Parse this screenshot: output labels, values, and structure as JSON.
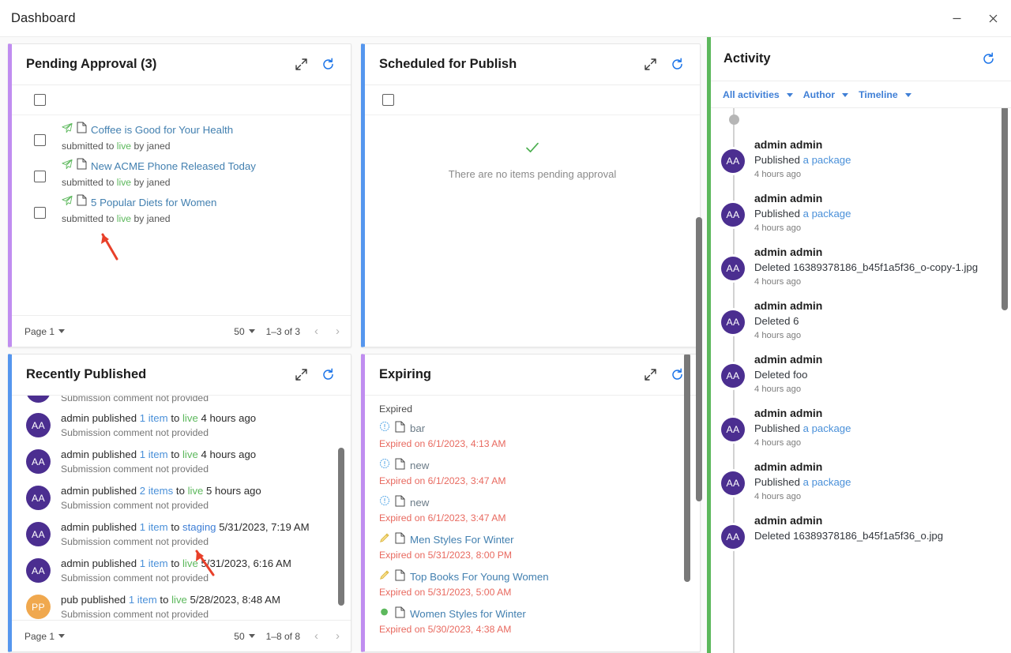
{
  "window": {
    "title": "Dashboard",
    "minimize_label": "Minimize",
    "close_label": "Close"
  },
  "pending_approval": {
    "title": "Pending Approval (3)",
    "expand_label": "Expand",
    "refresh_label": "Refresh",
    "items": [
      {
        "icon": "send-icon",
        "title": "Coffee is Good for Your Health",
        "prefix": "submitted to",
        "target": "live",
        "suffix": "by janed"
      },
      {
        "icon": "send-icon",
        "title": "New ACME Phone Released Today",
        "prefix": "submitted to",
        "target": "live",
        "suffix": "by janed"
      },
      {
        "icon": "send-icon",
        "title": "5 Popular Diets for Women",
        "prefix": "submitted to",
        "target": "live",
        "suffix": "by janed"
      }
    ],
    "pager": {
      "page_label": "Page 1",
      "per_page": "50",
      "range": "1–3 of 3"
    }
  },
  "scheduled_for_publish": {
    "title": "Scheduled for Publish",
    "empty_text": "There are no items pending approval",
    "empty_icon": "check-icon"
  },
  "recently_published": {
    "title": "Recently Published",
    "clipped_top_text": "Submission comment not provided",
    "items": [
      {
        "avatar": "AA",
        "avatar_color": "#4b2e90",
        "actor": "admin published",
        "count": "1 item",
        "to": "to",
        "target": "live",
        "target_type": "live",
        "time": "4 hours ago",
        "comment": "Submission comment not provided"
      },
      {
        "avatar": "AA",
        "avatar_color": "#4b2e90",
        "actor": "admin published",
        "count": "1 item",
        "to": "to",
        "target": "live",
        "target_type": "live",
        "time": "4 hours ago",
        "comment": "Submission comment not provided"
      },
      {
        "avatar": "AA",
        "avatar_color": "#4b2e90",
        "actor": "admin published",
        "count": "2 items",
        "to": "to",
        "target": "live",
        "target_type": "live",
        "time": "5 hours ago",
        "comment": "Submission comment not provided"
      },
      {
        "avatar": "AA",
        "avatar_color": "#4b2e90",
        "actor": "admin published",
        "count": "1 item",
        "to": "to",
        "target": "staging",
        "target_type": "staging",
        "time": "5/31/2023, 7:19 AM",
        "comment": "Submission comment not provided"
      },
      {
        "avatar": "AA",
        "avatar_color": "#4b2e90",
        "actor": "admin published",
        "count": "1 item",
        "to": "to",
        "target": "live",
        "target_type": "live",
        "time": "5/31/2023, 6:16 AM",
        "comment": "Submission comment not provided"
      },
      {
        "avatar": "PP",
        "avatar_color": "#f0a84e",
        "actor": "pub published",
        "count": "1 item",
        "to": "to",
        "target": "live",
        "target_type": "live",
        "time": "5/28/2023, 8:48 AM",
        "comment": "Submission comment not provided"
      }
    ],
    "pager": {
      "page_label": "Page 1",
      "per_page": "50",
      "range": "1–8 of 8"
    }
  },
  "expiring": {
    "title": "Expiring",
    "group_label": "Expired",
    "items": [
      {
        "status_icon": "warning-icon",
        "status_color": "#5aa9e6",
        "title": "bar",
        "date": "Expired on 6/1/2023, 4:13 AM",
        "title_color": "#6b7b87"
      },
      {
        "status_icon": "warning-icon",
        "status_color": "#5aa9e6",
        "title": "new",
        "date": "Expired on 6/1/2023, 3:47 AM",
        "title_color": "#6b7b87"
      },
      {
        "status_icon": "warning-icon",
        "status_color": "#5aa9e6",
        "title": "new",
        "date": "Expired on 6/1/2023, 3:47 AM",
        "title_color": "#6b7b87"
      },
      {
        "status_icon": "pencil-icon",
        "status_color": "#f0c330",
        "title": "Men Styles For Winter",
        "date": "Expired on 5/31/2023, 8:00 PM",
        "title_color": "#4380b0"
      },
      {
        "status_icon": "pencil-icon",
        "status_color": "#f0c330",
        "title": "Top Books For Young Women",
        "date": "Expired on 5/31/2023, 5:00 AM",
        "title_color": "#4380b0"
      },
      {
        "status_icon": "dot-icon",
        "status_color": "#5cb85c",
        "title": "Women Styles for Winter",
        "date": "Expired on 5/30/2023, 4:38 AM",
        "title_color": "#4380b0"
      }
    ]
  },
  "activity": {
    "title": "Activity",
    "refresh_label": "Refresh",
    "filters": [
      {
        "label": "All activities"
      },
      {
        "label": "Author"
      },
      {
        "label": "Timeline"
      }
    ],
    "items": [
      {
        "avatar": "AA",
        "name": "admin admin",
        "verb": "Published",
        "object": "a package",
        "object_is_link": true,
        "time": "4 hours ago"
      },
      {
        "avatar": "AA",
        "name": "admin admin",
        "verb": "Published",
        "object": "a package",
        "object_is_link": true,
        "time": "4 hours ago"
      },
      {
        "avatar": "AA",
        "name": "admin admin",
        "verb": "Deleted",
        "object": "16389378186_b45f1a5f36_o-copy-1.jpg",
        "object_is_link": false,
        "time": "4 hours ago"
      },
      {
        "avatar": "AA",
        "name": "admin admin",
        "verb": "Deleted",
        "object": "6",
        "object_is_link": false,
        "time": "4 hours ago"
      },
      {
        "avatar": "AA",
        "name": "admin admin",
        "verb": "Deleted",
        "object": "foo",
        "object_is_link": false,
        "time": "4 hours ago"
      },
      {
        "avatar": "AA",
        "name": "admin admin",
        "verb": "Published",
        "object": "a package",
        "object_is_link": true,
        "time": "4 hours ago"
      },
      {
        "avatar": "AA",
        "name": "admin admin",
        "verb": "Published",
        "object": "a package",
        "object_is_link": true,
        "time": "4 hours ago"
      },
      {
        "avatar": "AA",
        "name": "admin admin",
        "verb": "Deleted",
        "object": "16389378186_b45f1a5f36_o.jpg",
        "object_is_link": false,
        "time": ""
      }
    ]
  },
  "colors": {
    "accent_purple": "#c08df0",
    "accent_blue": "#5596ee",
    "accent_green": "#5cb85c",
    "link_blue": "#4a90d9",
    "title_link": "#4380b0",
    "expired_red": "#e8695f",
    "avatar_purple": "#4b2e90",
    "avatar_orange": "#f0a84e",
    "refresh_blue": "#1a73e8"
  }
}
